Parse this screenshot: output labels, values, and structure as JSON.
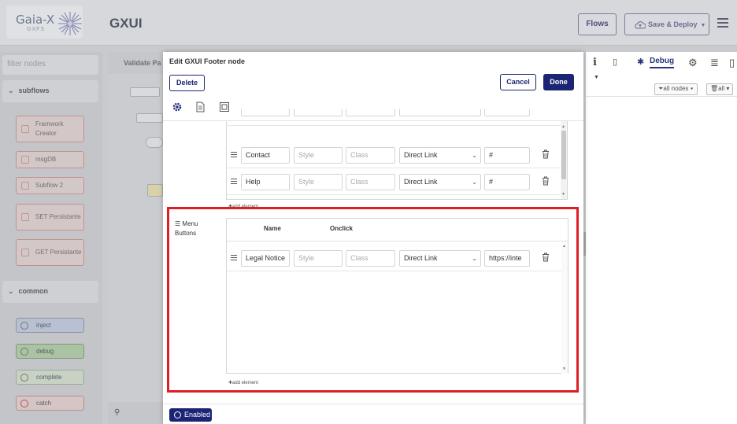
{
  "header": {
    "logo_text": "Gaia-X",
    "logo_sub": "GXFS",
    "app_title": "GXUI",
    "flows_label": "Flows",
    "deploy_label": "Save & Deploy"
  },
  "palette": {
    "filter_placeholder": "filter nodes",
    "subflows_label": "subflows",
    "subflow_nodes": [
      "Framwork Creator",
      "msgDB",
      "Subflow 2",
      "SET Persistante",
      "GET Persistante"
    ],
    "common_label": "common",
    "common_nodes": [
      {
        "label": "inject",
        "color": "#b9c0d1"
      },
      {
        "label": "debug",
        "color": "#a9c3a3"
      },
      {
        "label": "complete",
        "color": "#c7d2c5"
      },
      {
        "label": "catch",
        "color": "#d6c5c5"
      }
    ]
  },
  "workspace": {
    "tab_label": "Validate Pa"
  },
  "debug": {
    "tab_label": "Debug",
    "filter_nodes": "all nodes",
    "filter_all": "all"
  },
  "tray": {
    "title": "Edit GXUI Footer node",
    "delete_label": "Delete",
    "cancel_label": "Cancel",
    "done_label": "Done",
    "links_rows": [
      {
        "name": "Contact",
        "style_ph": "Style",
        "class_ph": "Class",
        "type": "Direct Link",
        "url": "#"
      },
      {
        "name": "Help",
        "style_ph": "Style",
        "class_ph": "Class",
        "type": "Direct Link",
        "url": "#"
      }
    ],
    "add_element_label": "add element",
    "menu_buttons_label": "Menu Buttons",
    "col_name": "Name",
    "col_onclick": "Onclick",
    "menu_rows": [
      {
        "name": "Legal Notice",
        "style_ph": "Style",
        "class_ph": "Class",
        "type": "Direct Link",
        "url": "https://inte"
      }
    ],
    "enabled_label": "Enabled"
  },
  "colors": {
    "accent": "#1b2574",
    "highlight": "#e01d25"
  }
}
